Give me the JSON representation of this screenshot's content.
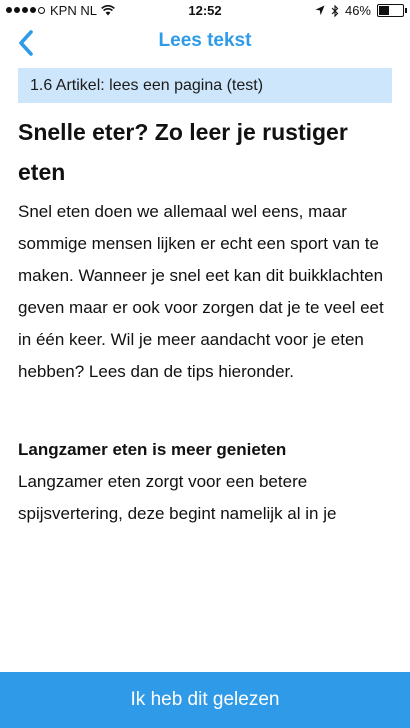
{
  "status_bar": {
    "carrier": "KPN NL",
    "time": "12:52",
    "battery": "46%",
    "battery_level": 0.46,
    "signal_bars": 4,
    "signal_max": 5
  },
  "nav": {
    "back_icon": "chevron-left-icon",
    "title": "Lees tekst",
    "accent_color": "#2f9be8"
  },
  "crumb": {
    "label": "1.6 Artikel: lees een pagina (test)",
    "background": "#cde6fb"
  },
  "article": {
    "title": "Snelle eter? Zo leer je rustiger eten",
    "intro": "Snel eten doen we allemaal wel eens, maar sommige mensen lijken er echt een sport van te maken. Wanneer je snel eet kan dit buikklachten geven maar er ook voor zorgen dat je te veel eet in één keer. Wil je meer aandacht voor je eten hebben? Lees dan de tips hieronder.",
    "section_heading": "Langzamer eten is meer genieten",
    "section_text": "Langzamer eten zorgt voor een betere spijsvertering, deze begint namelijk al in je"
  },
  "footer": {
    "button_label": "Ik heb dit gelezen"
  }
}
